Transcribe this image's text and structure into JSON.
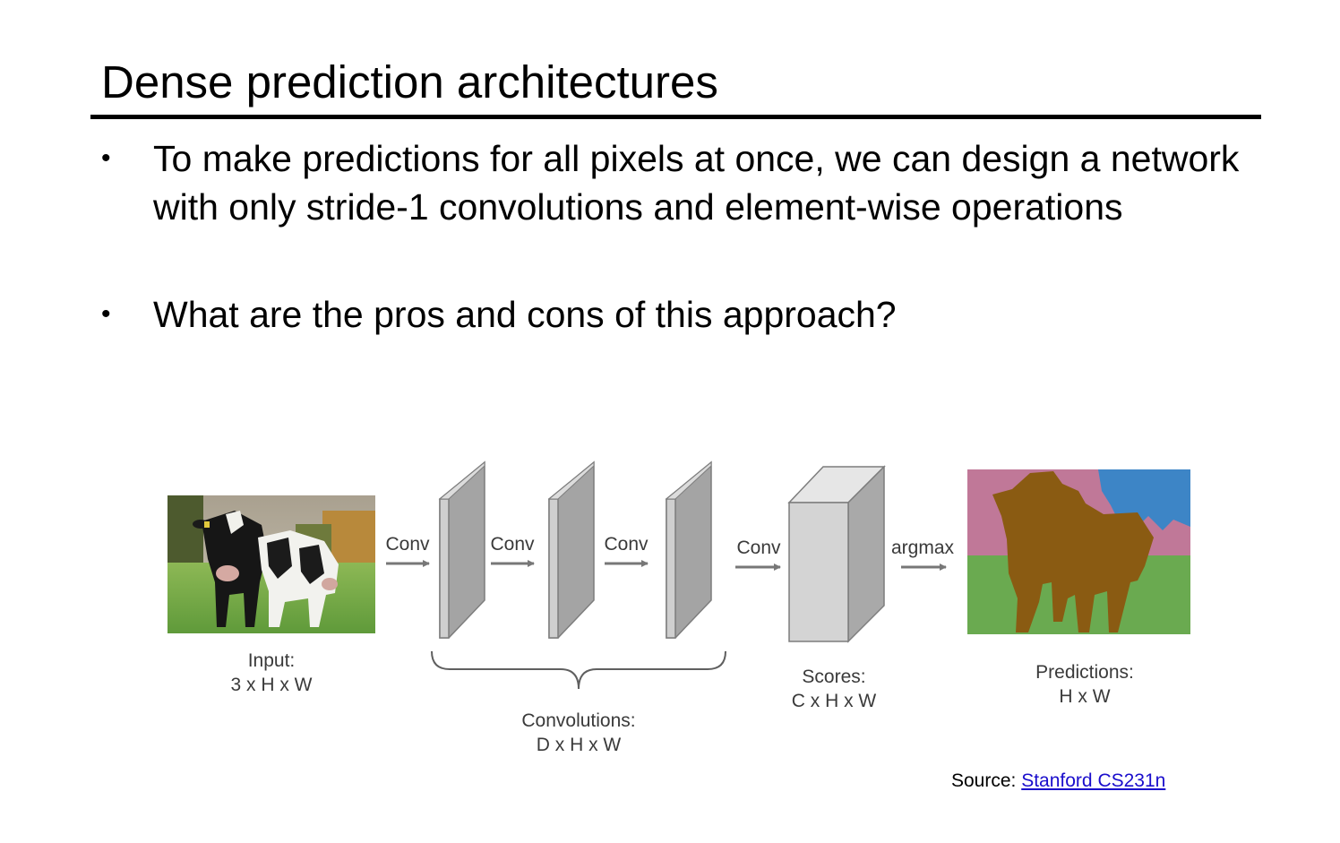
{
  "slide": {
    "title": "Dense prediction architectures",
    "bullets": [
      "To make predictions for all pixels at once, we can design a network with only stride-1 convolutions and element-wise operations",
      "What are the pros and cons of this approach?"
    ],
    "bullet_glyph": "•"
  },
  "diagram": {
    "input": {
      "label": "Input:",
      "dims": "3 x H x W"
    },
    "ops": {
      "conv": "Conv",
      "argmax": "argmax"
    },
    "convolutions": {
      "label": "Convolutions:",
      "dims": "D x H x W"
    },
    "scores": {
      "label": "Scores:",
      "dims": "C x H x W"
    },
    "predictions": {
      "label": "Predictions:",
      "dims": "H x W"
    },
    "colors": {
      "layer_front": "#a4a4a4",
      "layer_side": "#cfcfcf",
      "scores_front": "#d4d4d4",
      "scores_top": "#e6e6e6",
      "scores_side": "#a9a9a9",
      "seg_cow": "#8a5b12",
      "seg_grass": "#6aaa50",
      "seg_tree": "#c07898",
      "seg_sky": "#3d85c6"
    }
  },
  "source": {
    "prefix": "Source: ",
    "link_text": "Stanford CS231n"
  }
}
